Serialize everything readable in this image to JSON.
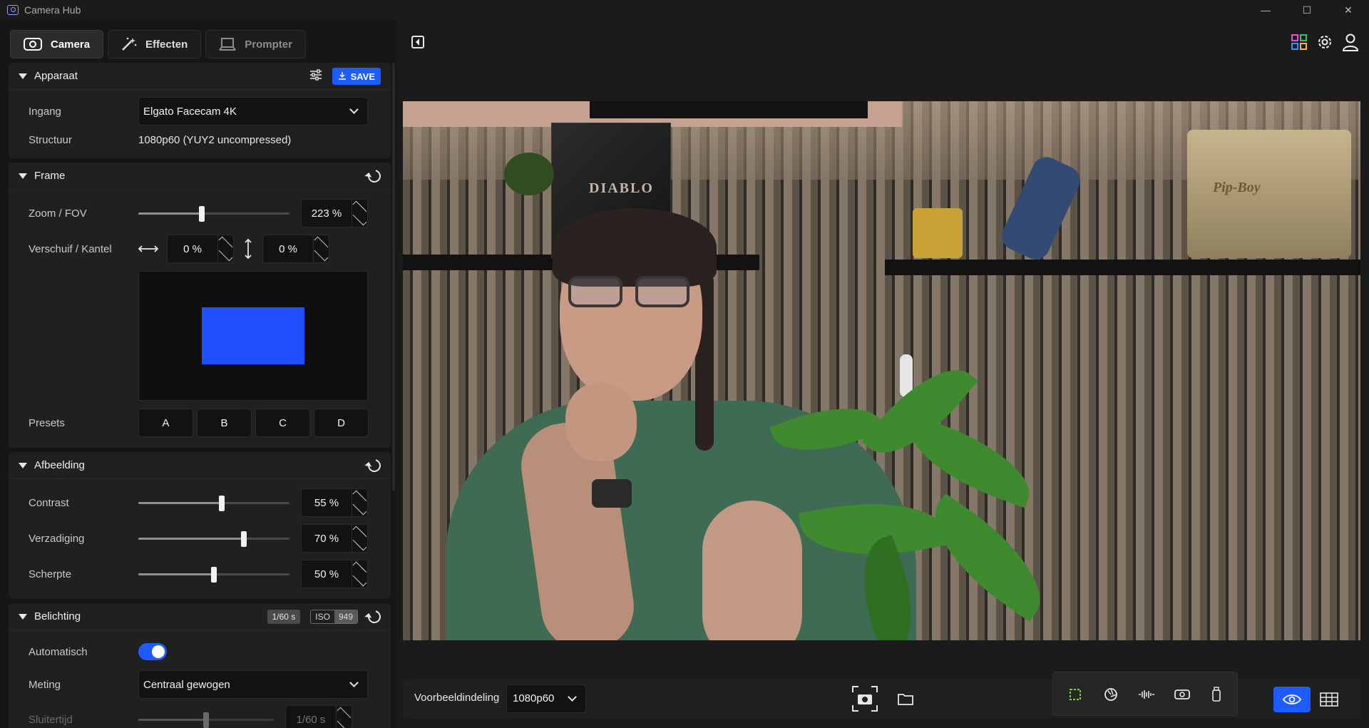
{
  "window": {
    "title": "Camera Hub",
    "minimize": "—",
    "maximize": "☐",
    "close": "✕"
  },
  "tabs": [
    {
      "label": "Camera",
      "icon": "camera-icon",
      "active": true
    },
    {
      "label": "Effecten",
      "icon": "magic-wand-icon",
      "active": false
    },
    {
      "label": "Prompter",
      "icon": "prompter-icon",
      "active": false
    }
  ],
  "sections": {
    "apparaat": {
      "title": "Apparaat",
      "save_label": "SAVE",
      "ingang_label": "Ingang",
      "ingang_value": "Elgato Facecam 4K",
      "structuur_label": "Structuur",
      "structuur_value": "1080p60 (YUY2 uncompressed)"
    },
    "frame": {
      "title": "Frame",
      "zoom_label": "Zoom / FOV",
      "zoom_value": "223 %",
      "zoom_level": 0.42,
      "pan_tilt_label": "Verschuif / Kantel",
      "pan_value": "0 %",
      "tilt_value": "0 %",
      "presets_label": "Presets",
      "presets": [
        "A",
        "B",
        "C",
        "D"
      ]
    },
    "afbeelding": {
      "title": "Afbeelding",
      "contrast_label": "Contrast",
      "contrast_value": "55 %",
      "contrast_level": 0.55,
      "verzadiging_label": "Verzadiging",
      "verzadiging_value": "70 %",
      "verzadiging_level": 0.7,
      "scherpte_label": "Scherpte",
      "scherpte_value": "50 %",
      "scherpte_level": 0.5
    },
    "belichting": {
      "title": "Belichting",
      "shutter_badge": "1/60 s",
      "iso_label": "ISO",
      "iso_value": "949",
      "auto_label": "Automatisch",
      "auto_on": true,
      "meting_label": "Meting",
      "meting_value": "Centraal gewogen",
      "sluitertijd_label": "Sluitertijd",
      "sluitertijd_value": "1/60 s",
      "sluitertijd_level": 0.5
    }
  },
  "video": {
    "box_text": "DIABLO",
    "pipboy_text": "Pip-Boy"
  },
  "bottom": {
    "layout_label": "Voorbeeldindeling",
    "layout_value": "1080p60"
  },
  "colors": {
    "accent": "#1f5cff",
    "panel": "#202020",
    "background": "#1b1b1b"
  }
}
